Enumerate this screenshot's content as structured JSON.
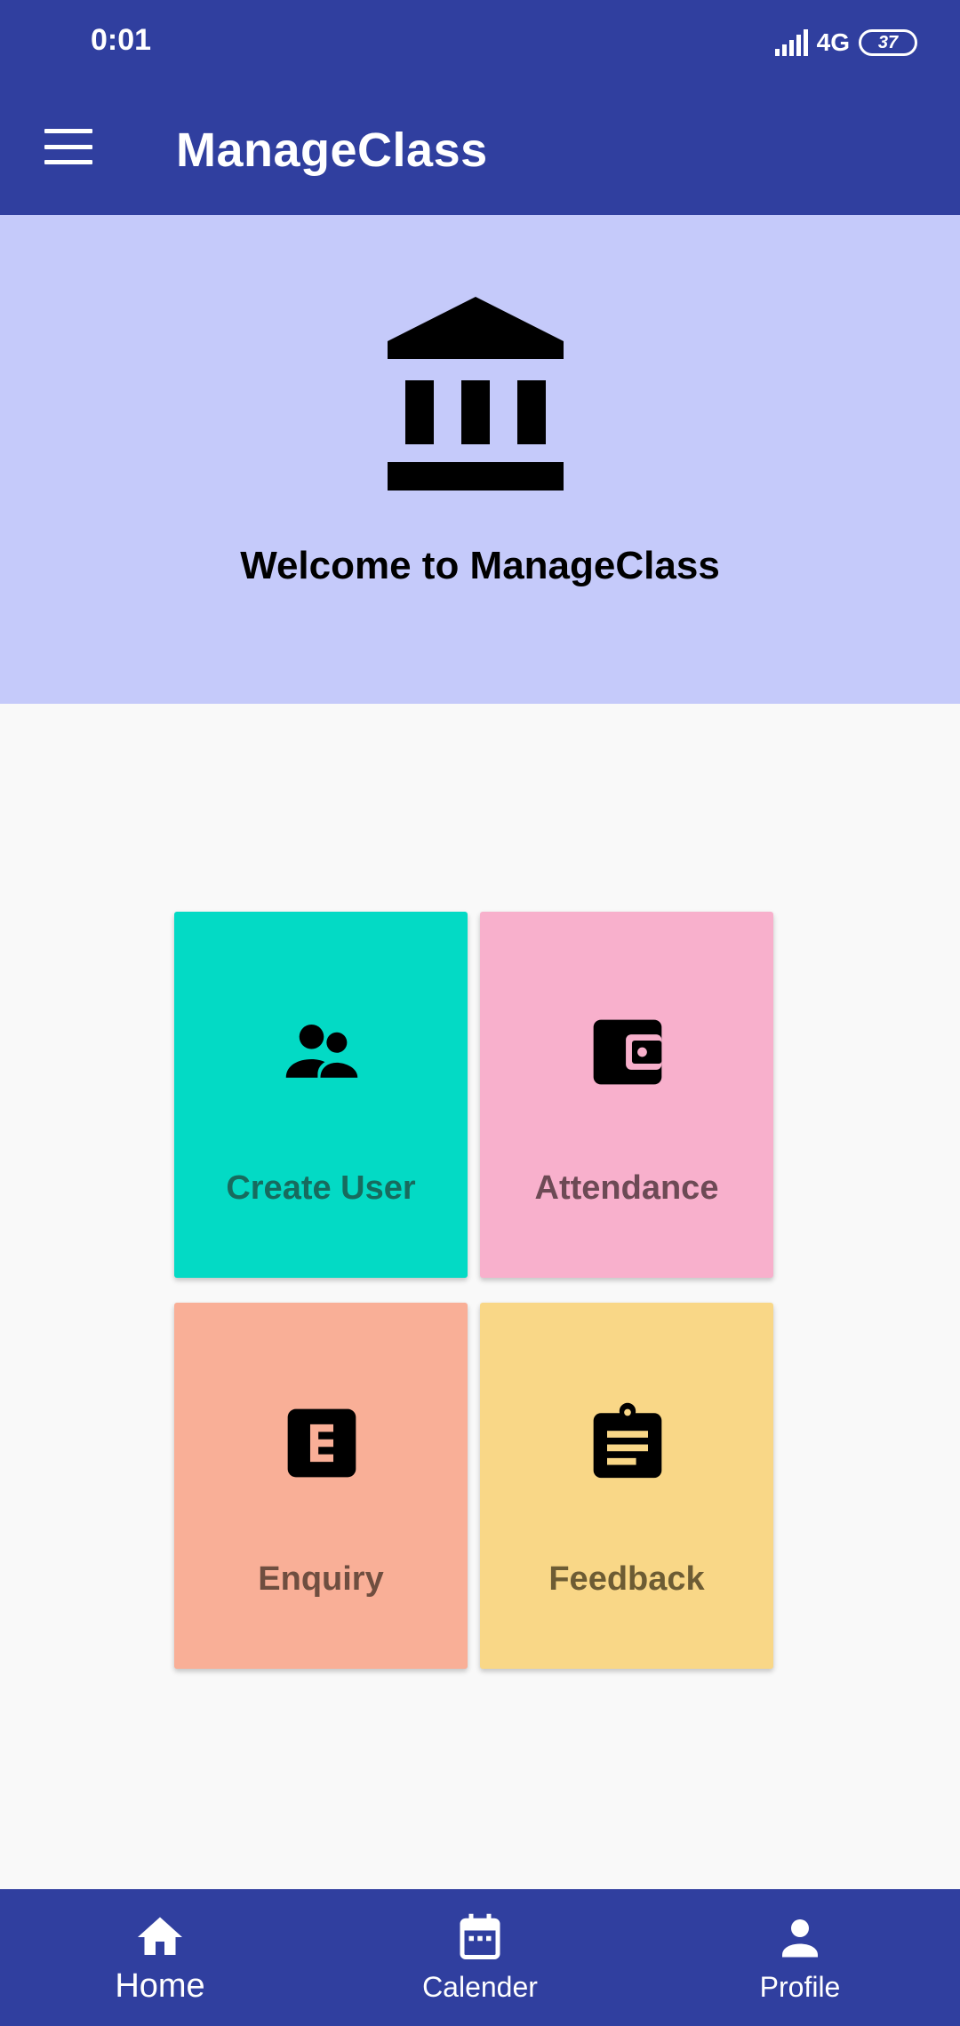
{
  "status_bar": {
    "time": "0:01",
    "network": "4G",
    "battery": "37"
  },
  "app_bar": {
    "title": "ManageClass",
    "menu_icon": "hamburger-menu-icon"
  },
  "hero": {
    "icon": "institution-icon",
    "welcome_text": "Welcome to ManageClass"
  },
  "cards": [
    {
      "label": "Create User",
      "icon": "people-icon",
      "color": "#03dac5"
    },
    {
      "label": "Attendance",
      "icon": "wallet-icon",
      "color": "#f8b0cc"
    },
    {
      "label": "Enquiry",
      "icon": "letter-e-icon",
      "color": "#f9af97"
    },
    {
      "label": "Feedback",
      "icon": "clipboard-icon",
      "color": "#f9d787"
    }
  ],
  "bottom_nav": [
    {
      "label": "Home",
      "icon": "home-icon",
      "active": true
    },
    {
      "label": "Calender",
      "icon": "calendar-icon",
      "active": false
    },
    {
      "label": "Profile",
      "icon": "person-icon",
      "active": false
    }
  ],
  "colors": {
    "primary": "#303f9f",
    "hero_background": "#c5cafa",
    "page_background": "#f9f9f9"
  }
}
